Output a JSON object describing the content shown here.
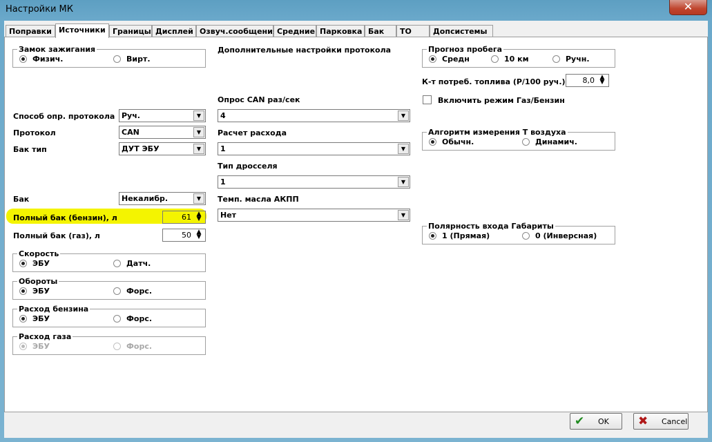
{
  "window": {
    "title": "Настройки МК",
    "close_glyph": "✕"
  },
  "tabs": [
    "Поправки",
    "Источники",
    "Границы",
    "Дисплей",
    "Озвуч.сообщения",
    "Средние",
    "Парковка",
    "Бак",
    "ТО",
    "Допсистемы"
  ],
  "left": {
    "ignition_group": {
      "title": "Замок зажигания",
      "opt1": "Физич.",
      "opt2": "Вирт."
    },
    "protocol_method": {
      "label": "Способ опр. протокола",
      "value": "Руч."
    },
    "protocol": {
      "label": "Протокол",
      "value": "CAN"
    },
    "tank_type": {
      "label": "Бак тип",
      "value": "ДУТ ЭБУ"
    },
    "tank": {
      "label": "Бак",
      "value": "Некалибр."
    },
    "full_tank_petrol": {
      "label": "Полный бак (бензин), л",
      "value": "61"
    },
    "full_tank_gas": {
      "label": "Полный бак (газ), л",
      "value": "50"
    },
    "speed_group": {
      "title": "Скорость",
      "opt1": "ЭБУ",
      "opt2": "Датч."
    },
    "rpm_group": {
      "title": "Обороты",
      "opt1": "ЭБУ",
      "opt2": "Форс."
    },
    "petrol_flow_group": {
      "title": "Расход бензина",
      "opt1": "ЭБУ",
      "opt2": "Форс."
    },
    "gas_flow_group": {
      "title": "Расход газа",
      "opt1": "ЭБУ",
      "opt2": "Форс."
    }
  },
  "middle": {
    "extra_title": "Дополнительные настройки протокола",
    "can_poll": {
      "label": "Опрос CAN раз/сек",
      "value": "4"
    },
    "consumption": {
      "label": "Расчет расхода",
      "value": "1"
    },
    "throttle": {
      "label": "Тип дросселя",
      "value": "1"
    },
    "oil_temp": {
      "label": "Темп. масла АКПП",
      "value": "Нет"
    }
  },
  "right": {
    "forecast_group": {
      "title": "Прогноз пробега",
      "opt1": "Средн",
      "opt2": "10 км",
      "opt3": "Ручн."
    },
    "fuel_coef": {
      "label": "К-т потреб. топлива (Р/100 руч.)",
      "value": "8,0"
    },
    "gas_mode": {
      "label": "Включить режим Газ/Бензин"
    },
    "air_group": {
      "title": "Алгоритм измерения Т воздуха",
      "opt1": "Обычн.",
      "opt2": "Динамич."
    },
    "polarity_group": {
      "title": "Полярность входа Габариты",
      "opt1": "1 (Прямая)",
      "opt2": "0 (Инверсная)"
    }
  },
  "footer": {
    "ok": "OK",
    "cancel": "Cancel",
    "ok_glyph": "✔",
    "cancel_glyph": "✖"
  },
  "colors": {
    "highlight": "#f4f400",
    "title_bar": "#6ba9cb",
    "close": "#c0442d"
  }
}
